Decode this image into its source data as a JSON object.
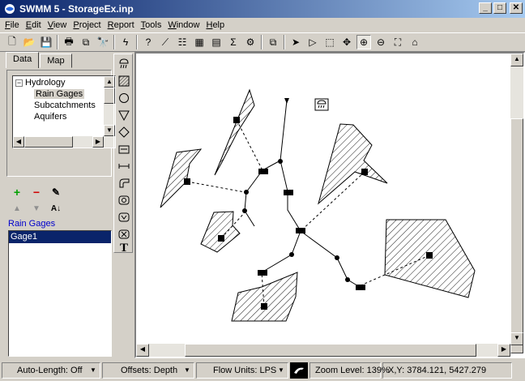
{
  "window": {
    "title": "SWMM 5 - StorageEx.inp",
    "controls": [
      "_",
      "□",
      "✕"
    ]
  },
  "menu": [
    {
      "label": "File",
      "hotkey": "F"
    },
    {
      "label": "Edit",
      "hotkey": "E"
    },
    {
      "label": "View",
      "hotkey": "V"
    },
    {
      "label": "Project",
      "hotkey": "P"
    },
    {
      "label": "Report",
      "hotkey": "R"
    },
    {
      "label": "Tools",
      "hotkey": "T"
    },
    {
      "label": "Window",
      "hotkey": "W"
    },
    {
      "label": "Help",
      "hotkey": "H"
    }
  ],
  "toolbar": {
    "buttons": [
      {
        "name": "new-icon",
        "glyph": "🗋"
      },
      {
        "name": "open-icon",
        "glyph": "📂"
      },
      {
        "name": "save-icon",
        "glyph": "💾"
      },
      {
        "name": "print-icon",
        "glyph": "🖶"
      },
      {
        "name": "copy-icon",
        "glyph": "⧉"
      },
      {
        "name": "find-icon",
        "glyph": "🔭"
      },
      {
        "name": "run-icon",
        "glyph": "ϟ"
      },
      {
        "name": "query-icon",
        "glyph": "?"
      },
      {
        "name": "profile-plot-icon",
        "glyph": "⟋"
      },
      {
        "name": "time-series-plot-icon",
        "glyph": "☷"
      },
      {
        "name": "scatter-plot-icon",
        "glyph": "▦"
      },
      {
        "name": "table-icon",
        "glyph": "▤"
      },
      {
        "name": "statistics-icon",
        "glyph": "Σ"
      },
      {
        "name": "options-icon",
        "glyph": "⚙"
      },
      {
        "name": "arrange-windows-icon",
        "glyph": "⧉"
      },
      {
        "name": "select-object-icon",
        "glyph": "➤"
      },
      {
        "name": "select-vertex-icon",
        "glyph": "▷"
      },
      {
        "name": "select-region-icon",
        "glyph": "⬚"
      },
      {
        "name": "pan-icon",
        "glyph": "✥"
      },
      {
        "name": "zoom-in-icon",
        "glyph": "⊕"
      },
      {
        "name": "zoom-out-icon",
        "glyph": "⊖"
      },
      {
        "name": "full-extent-icon",
        "glyph": "⛶"
      },
      {
        "name": "measure-icon",
        "glyph": "⌂"
      }
    ]
  },
  "browser": {
    "tabs": [
      "Data",
      "Map"
    ],
    "active_tab": "Data",
    "tree": [
      {
        "label": "Hydrology",
        "indent": 0,
        "expander": "−"
      },
      {
        "label": "Rain Gages",
        "indent": 1,
        "selected": true
      },
      {
        "label": "Subcatchments",
        "indent": 1
      },
      {
        "label": "Aquifers",
        "indent": 1
      }
    ],
    "object_label": "Rain Gages",
    "objects": [
      {
        "label": "Gage1",
        "selected": true
      }
    ]
  },
  "status": {
    "auto_length": "Auto-Length: Off",
    "offsets": "Offsets: Depth",
    "flow_units": "Flow Units: LPS",
    "zoom": "Zoom Level: 139%",
    "xy": "X,Y: 3784.121, 5427.279"
  },
  "colors": {
    "title_start": "#0a246a",
    "title_end": "#a6caf0",
    "selection": "#0a246a",
    "add_green": "#00a000",
    "delete_red": "#d00000"
  }
}
